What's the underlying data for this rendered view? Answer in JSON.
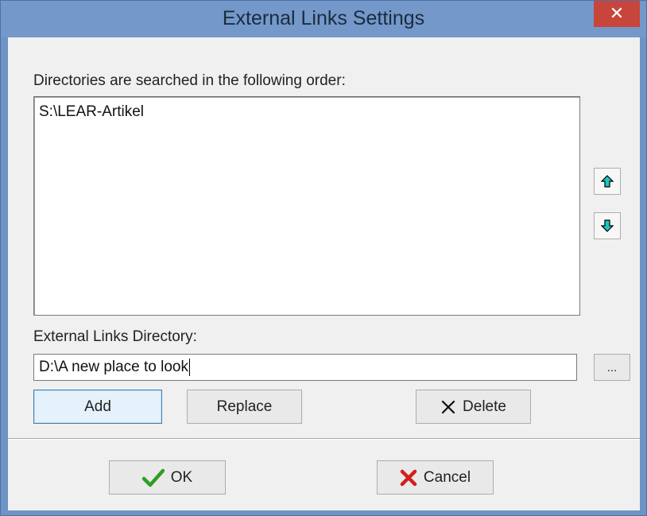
{
  "window": {
    "title": "External Links Settings",
    "close_glyph": "✕"
  },
  "directories": {
    "label": "Directories are searched in the following order:",
    "items": [
      "S:\\LEAR-Artikel"
    ]
  },
  "order_buttons": {
    "up_icon": "arrow-up-icon",
    "down_icon": "arrow-down-icon",
    "arrow_color": "#1cc7c0"
  },
  "external_dir": {
    "label": "External Links Directory:",
    "value": "D:\\A new place to look",
    "browse_label": "..."
  },
  "actions": {
    "add_label": "Add",
    "replace_label": "Replace",
    "delete_label": "Delete"
  },
  "footer": {
    "ok_label": "OK",
    "cancel_label": "Cancel",
    "ok_icon_color": "#2e9e25",
    "cancel_icon_color": "#d21f1f"
  }
}
